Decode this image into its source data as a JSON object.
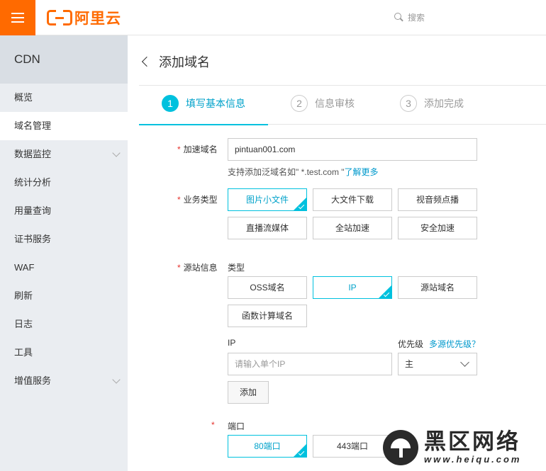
{
  "topbar": {
    "brand": "阿里云",
    "search_label": "搜索"
  },
  "sidebar": {
    "title": "CDN",
    "items": [
      {
        "label": "概览"
      },
      {
        "label": "域名管理"
      },
      {
        "label": "数据监控"
      },
      {
        "label": "统计分析"
      },
      {
        "label": "用量查询"
      },
      {
        "label": "证书服务"
      },
      {
        "label": "WAF"
      },
      {
        "label": "刷新"
      },
      {
        "label": "日志"
      },
      {
        "label": "工具"
      },
      {
        "label": "增值服务"
      }
    ]
  },
  "page": {
    "title": "添加域名"
  },
  "steps": [
    {
      "num": "1",
      "label": "填写基本信息"
    },
    {
      "num": "2",
      "label": "信息审核"
    },
    {
      "num": "3",
      "label": "添加完成"
    }
  ],
  "form": {
    "domain": {
      "label": "加速域名",
      "value": "pintuan001.com",
      "hint_prefix": "支持添加泛域名如\" *.test.com \"",
      "hint_link": "了解更多"
    },
    "business": {
      "label": "业务类型",
      "options": [
        "图片小文件",
        "大文件下载",
        "视音频点播",
        "直播流媒体",
        "全站加速",
        "安全加速"
      ],
      "selected": "图片小文件"
    },
    "origin": {
      "label": "源站信息",
      "type_label": "类型",
      "types": [
        "OSS域名",
        "IP",
        "源站域名",
        "函数计算域名"
      ],
      "selected": "IP",
      "ip_label": "IP",
      "ip_placeholder": "请输入单个IP",
      "priority_label": "优先级",
      "priority_link": "多源优先级？",
      "priority_value": "主",
      "add_button": "添加"
    },
    "port": {
      "label": "端口",
      "options": [
        "80端口",
        "443端口"
      ],
      "selected": "80端口"
    }
  },
  "watermark": {
    "title": "黑区网络",
    "url": "www.heiqu.com"
  }
}
